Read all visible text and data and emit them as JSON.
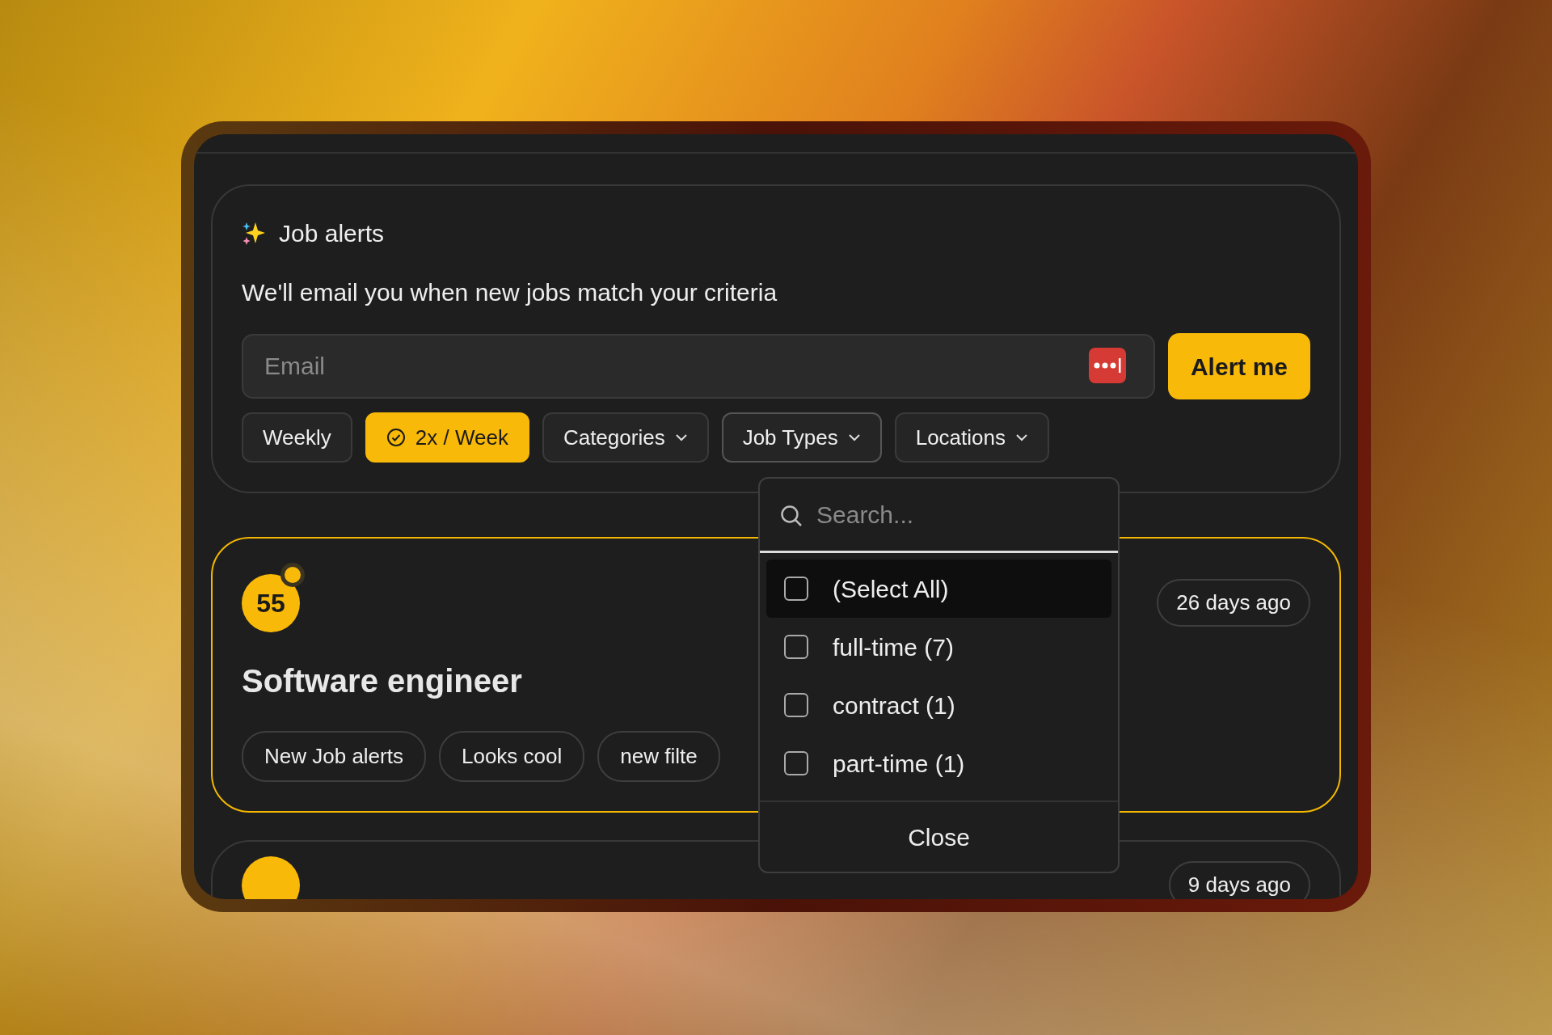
{
  "alert_form": {
    "title": "Job alerts",
    "subtitle": "We'll email you when new jobs match your criteria",
    "email": {
      "placeholder": "Email"
    },
    "submit": "Alert me",
    "filters": [
      {
        "kind": "frequency",
        "label": "Weekly",
        "selected": false
      },
      {
        "kind": "frequency",
        "label": "2x / Week",
        "selected": true
      },
      {
        "kind": "dropdown",
        "label": "Categories",
        "expanded": false
      },
      {
        "kind": "dropdown",
        "label": "Job Types",
        "expanded": true
      },
      {
        "kind": "dropdown",
        "label": "Locations",
        "expanded": false
      }
    ]
  },
  "dropdown": {
    "search": {
      "placeholder": "Search..."
    },
    "options": [
      {
        "label": "(Select All)",
        "checked": false,
        "highlighted": true
      },
      {
        "label": "full-time (7)",
        "checked": false,
        "highlighted": false
      },
      {
        "label": "contract (1)",
        "checked": false,
        "highlighted": false
      },
      {
        "label": "part-time (1)",
        "checked": false,
        "highlighted": false
      }
    ],
    "close": "Close"
  },
  "jobs": [
    {
      "score": "55",
      "unread": true,
      "title": "Software engineer",
      "age": "26 days ago",
      "selected": true,
      "tags": [
        "New Job alerts",
        "Looks cool",
        "new filte"
      ]
    },
    {
      "age": "9 days ago",
      "selected": false
    }
  ]
}
